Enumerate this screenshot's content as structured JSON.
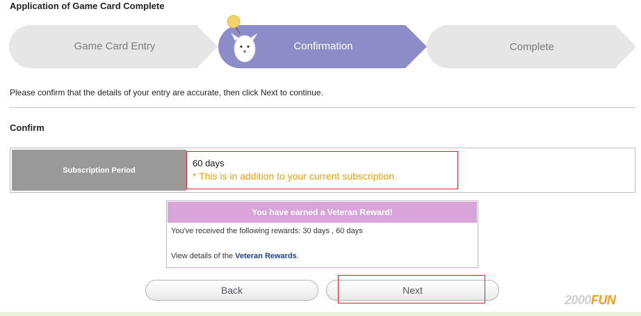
{
  "page": {
    "title": "Application of Game Card Complete"
  },
  "steps": [
    {
      "label": "Game Card Entry",
      "state": "done"
    },
    {
      "label": "Confirmation",
      "state": "active"
    },
    {
      "label": "Complete",
      "state": "pending"
    }
  ],
  "instruction": "Please confirm that the details of your entry are accurate, then click Next to continue.",
  "confirm": {
    "section_title": "Confirm",
    "row_label": "Subscription Period",
    "value": "60 days",
    "note": "* This is in addition to your current subscription."
  },
  "reward": {
    "header": "You have earned a Veteran Reward!",
    "received_text": "You've received the following rewards: 30 days , 60 days",
    "details_prefix": "View details of the ",
    "details_link": "Veteran Rewards",
    "details_suffix": "."
  },
  "buttons": {
    "back": "Back",
    "next": "Next"
  },
  "watermark": {
    "text_main": "2000",
    "text_accent": "FUN"
  },
  "colors": {
    "active_step": "#8b8cc8",
    "inactive_step": "#e6e6e6",
    "note": "#e8a000",
    "highlight": "#d8202c",
    "reward_header": "#d9a5d9",
    "link": "#1f3f8f"
  }
}
